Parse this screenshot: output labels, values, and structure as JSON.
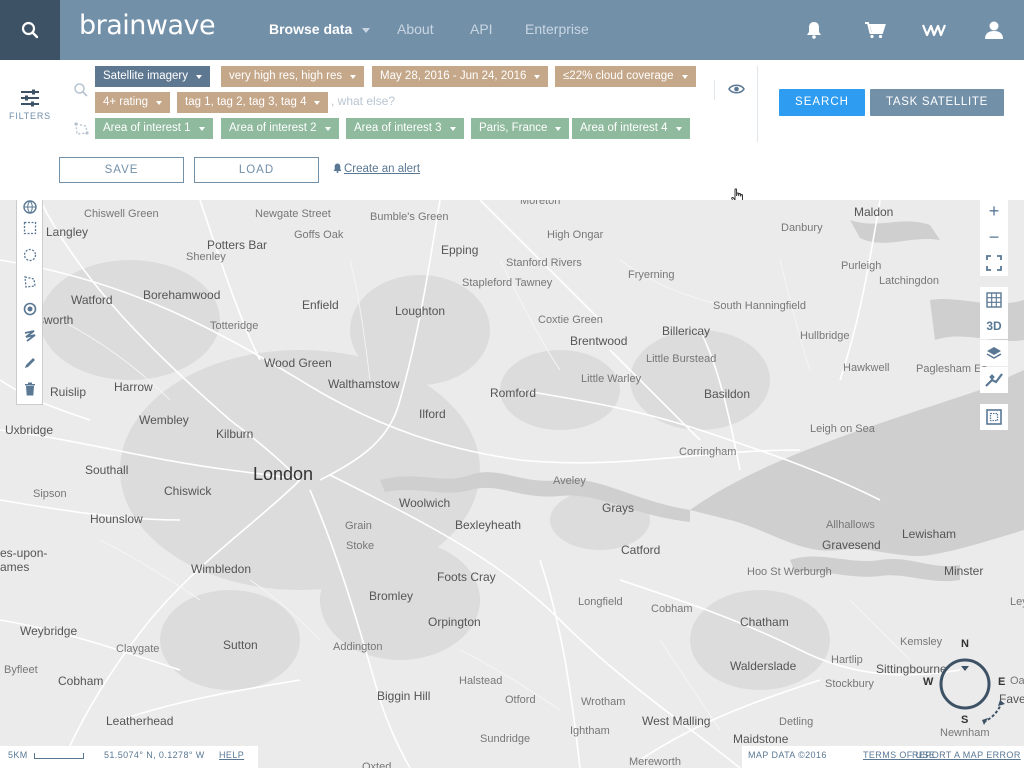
{
  "header": {
    "logo": "brainwave",
    "nav": [
      "Browse data",
      "About",
      "API",
      "Enterprise"
    ],
    "icons": [
      "search-icon",
      "bell-icon",
      "cart-icon",
      "wave-icon",
      "user-icon"
    ]
  },
  "filters": {
    "label": "FILTERS",
    "chips_row1": [
      "Satellite imagery",
      "very high res, high res",
      "May 28, 2016 - Jun 24, 2016",
      "≤22% cloud coverage"
    ],
    "chips_row2": [
      "4+ rating",
      "tag 1, tag 2, tag 3, tag 4"
    ],
    "what_else_placeholder": ", what else?",
    "chips_row3": [
      "Area of interest 1",
      "Area of interest 2",
      "Area of interest 3",
      "Paris, France",
      "Area of interest 4"
    ],
    "search_button": "SEARCH",
    "task_button": "TASK SATELLITE",
    "save_button": "SAVE",
    "load_button": "LOAD",
    "create_alert": "Create an alert"
  },
  "map": {
    "places": [
      {
        "name": "London",
        "style": "big"
      },
      {
        "name": "Chiswell Green",
        "style": "sm"
      },
      {
        "name": "Langley",
        "style": ""
      },
      {
        "name": "Potters Bar",
        "style": ""
      },
      {
        "name": "Newgate Street",
        "style": "sm"
      },
      {
        "name": "Goffs Oak",
        "style": "sm"
      },
      {
        "name": "Bumble's Green",
        "style": "sm"
      },
      {
        "name": "Moreton",
        "style": "sm"
      },
      {
        "name": "Epping",
        "style": ""
      },
      {
        "name": "High Ongar",
        "style": "sm"
      },
      {
        "name": "Danbury",
        "style": "sm"
      },
      {
        "name": "Maldon",
        "style": ""
      },
      {
        "name": "Shenley",
        "style": "sm"
      },
      {
        "name": "Stanford Rivers",
        "style": "sm"
      },
      {
        "name": "Fryerning",
        "style": "sm"
      },
      {
        "name": "Purleigh",
        "style": "sm"
      },
      {
        "name": "Stapleford Tawney",
        "style": "sm"
      },
      {
        "name": "Latchingdon",
        "style": "sm"
      },
      {
        "name": "Watford",
        "style": ""
      },
      {
        "name": "Borehamwood",
        "style": ""
      },
      {
        "name": "Enfield",
        "style": ""
      },
      {
        "name": "Loughton",
        "style": ""
      },
      {
        "name": "South Hanningfield",
        "style": "sm"
      },
      {
        "name": "sworth",
        "style": ""
      },
      {
        "name": "Totteridge",
        "style": "sm"
      },
      {
        "name": "Coxtie Green",
        "style": "sm"
      },
      {
        "name": "Billericay",
        "style": ""
      },
      {
        "name": "Hullbridge",
        "style": "sm"
      },
      {
        "name": "Brentwood",
        "style": ""
      },
      {
        "name": "Little Burstead",
        "style": "sm"
      },
      {
        "name": "Wood Green",
        "style": ""
      },
      {
        "name": "Walthamstow",
        "style": ""
      },
      {
        "name": "Hawkwell",
        "style": "sm"
      },
      {
        "name": "Paglesham Ea",
        "style": "sm"
      },
      {
        "name": "Ruislip",
        "style": ""
      },
      {
        "name": "Harrow",
        "style": ""
      },
      {
        "name": "Little Warley",
        "style": "sm"
      },
      {
        "name": "Romford",
        "style": ""
      },
      {
        "name": "Basildon",
        "style": ""
      },
      {
        "name": "Ilford",
        "style": ""
      },
      {
        "name": "Wembley",
        "style": ""
      },
      {
        "name": "Uxbridge",
        "style": ""
      },
      {
        "name": "Kilburn",
        "style": ""
      },
      {
        "name": "Leigh on Sea",
        "style": "sm"
      },
      {
        "name": "Corringham",
        "style": "sm"
      },
      {
        "name": "Southall",
        "style": ""
      },
      {
        "name": "Chiswick",
        "style": ""
      },
      {
        "name": "Aveley",
        "style": "sm"
      },
      {
        "name": "Sipson",
        "style": "sm"
      },
      {
        "name": "Woolwich",
        "style": ""
      },
      {
        "name": "Grays",
        "style": ""
      },
      {
        "name": "Hounslow",
        "style": ""
      },
      {
        "name": "Allhallows",
        "style": "sm"
      },
      {
        "name": "Bexleyheath",
        "style": ""
      },
      {
        "name": "Lewisham",
        "style": ""
      },
      {
        "name": "Grain",
        "style": "sm"
      },
      {
        "name": "Catford",
        "style": ""
      },
      {
        "name": "Gravesend",
        "style": ""
      },
      {
        "name": "Stoke",
        "style": "sm"
      },
      {
        "name": "es-upon-",
        "style": ""
      },
      {
        "name": "ames",
        "style": ""
      },
      {
        "name": "Wimbledon",
        "style": ""
      },
      {
        "name": "Foots Cray",
        "style": ""
      },
      {
        "name": "Hoo St Werburgh",
        "style": "sm"
      },
      {
        "name": "Minster",
        "style": ""
      },
      {
        "name": "Bromley",
        "style": ""
      },
      {
        "name": "Longfield",
        "style": "sm"
      },
      {
        "name": "Cobham",
        "style": "sm"
      },
      {
        "name": "Weybridge",
        "style": ""
      },
      {
        "name": "Claygate",
        "style": "sm"
      },
      {
        "name": "Orpington",
        "style": ""
      },
      {
        "name": "Chatham",
        "style": ""
      },
      {
        "name": "Ley",
        "style": "sm"
      },
      {
        "name": "Sutton",
        "style": ""
      },
      {
        "name": "Addington",
        "style": "sm"
      },
      {
        "name": "Kemsley",
        "style": "sm"
      },
      {
        "name": "Byfleet",
        "style": "sm"
      },
      {
        "name": "Walderslade",
        "style": ""
      },
      {
        "name": "Hartlip",
        "style": "sm"
      },
      {
        "name": "Sittingbourne",
        "style": ""
      },
      {
        "name": "Cobham",
        "style": ""
      },
      {
        "name": "Halstead",
        "style": "sm"
      },
      {
        "name": "Stockbury",
        "style": "sm"
      },
      {
        "name": "Oa",
        "style": "sm"
      },
      {
        "name": "Biggin Hill",
        "style": ""
      },
      {
        "name": "Otford",
        "style": "sm"
      },
      {
        "name": "Wrotham",
        "style": "sm"
      },
      {
        "name": "Fave",
        "style": ""
      },
      {
        "name": "Leatherhead",
        "style": ""
      },
      {
        "name": "West Malling",
        "style": ""
      },
      {
        "name": "Detling",
        "style": "sm"
      },
      {
        "name": "Ightham",
        "style": "sm"
      },
      {
        "name": "Sundridge",
        "style": "sm"
      },
      {
        "name": "Newnham",
        "style": "sm"
      },
      {
        "name": "Oxted",
        "style": "sm"
      },
      {
        "name": "Mereworth",
        "style": "sm"
      },
      {
        "name": "Maidstone",
        "style": ""
      }
    ],
    "zoom_in": "+",
    "zoom_out": "−",
    "btn_3d": "3D",
    "compass": {
      "n": "N",
      "e": "E",
      "s": "S",
      "w": "W"
    }
  },
  "footer": {
    "scale": "5KM",
    "coords": "51.5074° N, 0.1278° W",
    "help": "HELP",
    "map_data": "MAP DATA ©2016",
    "terms": "TERMS OF USE",
    "report": "REPORT A MAP ERROR"
  },
  "colors": {
    "header_bg": "#7390a9",
    "search_bg": "#3e5266",
    "chip_blue": "#5f7891",
    "chip_tan": "#c5a78a",
    "chip_green": "#8fba9e",
    "search_button": "#2e9df1"
  }
}
